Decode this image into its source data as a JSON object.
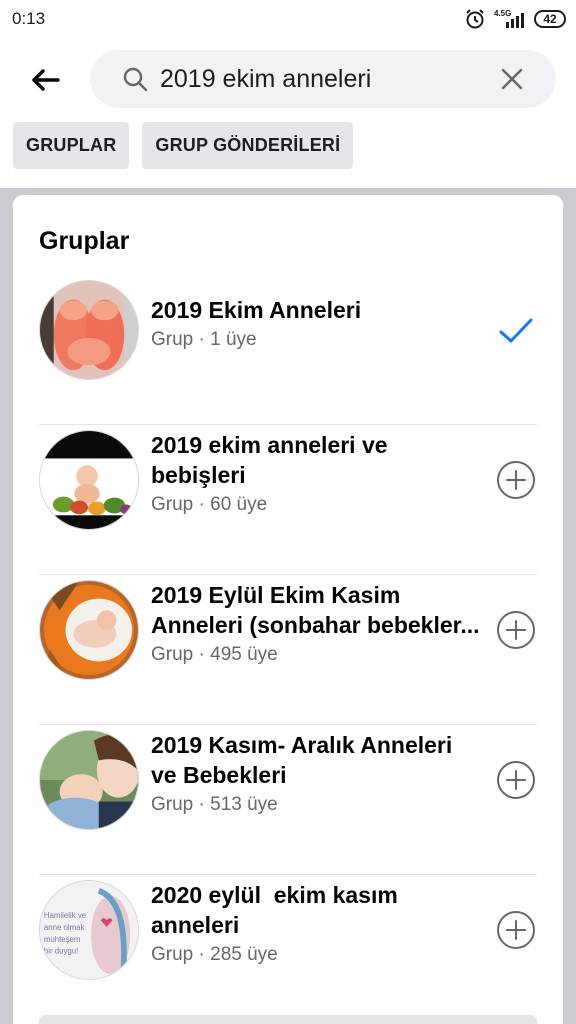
{
  "status": {
    "time": "0:13",
    "network": "4.5G",
    "battery": "42"
  },
  "search": {
    "value": "2019 ekim anneleri"
  },
  "filters": [
    {
      "label": "GRUPLAR"
    },
    {
      "label": "GRUP GÖNDERİLERİ"
    }
  ],
  "section": {
    "title": "Gruplar"
  },
  "groups": [
    {
      "title_line1": "2019 Ekim Anneleri",
      "title_line2": "",
      "meta": "Grup · 1 üye",
      "action": "checkmark-icon"
    },
    {
      "title_line1": "2019 ekim anneleri ve",
      "title_line2": "bebişleri",
      "meta": "Grup · 60 üye",
      "action": "add-circle-icon"
    },
    {
      "title_line1": "2019 Eylül Ekim Kasim",
      "title_line2": "Anneleri (sonbahar bebekler...",
      "meta": "Grup · 495 üye",
      "action": "add-circle-icon"
    },
    {
      "title_line1": "2019 Kasım- Aralık Anneleri",
      "title_line2": "ve Bebekleri",
      "meta": "Grup · 513 üye",
      "action": "add-circle-icon"
    },
    {
      "title_line1": "2020 eylül  ekim kasım",
      "title_line2": "anneleri",
      "meta": "Grup · 285 üye",
      "action": "add-circle-icon"
    }
  ],
  "avatar5_text": [
    "Hamilelik ve",
    "anne olmak",
    "muhteşem",
    "bir duygu!"
  ],
  "colors": {
    "accent": "#1877f2",
    "icon_gray": "#65676b",
    "chip_bg": "#e4e6eb",
    "search_bg": "#f0f2f5",
    "feed_bg": "#c9ccd1"
  }
}
